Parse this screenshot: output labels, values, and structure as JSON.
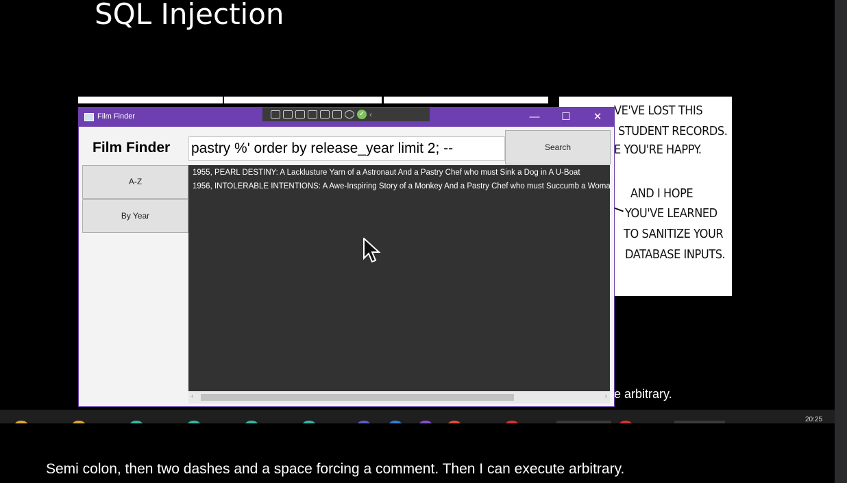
{
  "slide": {
    "title": "SQL Injection"
  },
  "comic": {
    "lines": [
      "VE'VE LOST THIS",
      "STUDENT RECORDS.",
      "E YOU'RE HAPPY.",
      "AND I HOPE",
      "YOU'VE LEARNED",
      "TO SANITIZE YOUR",
      "DATABASE INPUTS."
    ]
  },
  "window": {
    "title": "Film Finder",
    "minimize": "—",
    "maximize": "☐",
    "close": "✕",
    "heading": "Film Finder",
    "search_value": "pastry %' order by release_year limit 2; --",
    "search_button": "Search",
    "sort_az": "A-Z",
    "sort_year": "By Year",
    "results": [
      "1955, PEARL DESTINY: A Lacklusture Yarn of a Astronaut And a Pastry Chef who must Sink a Dog in A U-Boat",
      "1956, INTOLERABLE INTENTIONS: A Awe-Inspiring Story of a Monkey And a Pastry Chef who must Succumb a Woma"
    ]
  },
  "caption_behind": "e arbitrary.",
  "taskbar": {
    "time": "20:25"
  },
  "subtitle": "Semi colon, then two dashes and a space forcing a comment. Then I can execute arbitrary.",
  "colors": {
    "titlebar": "#6e3fb0",
    "results_bg": "#323232",
    "page_bg": "#000000"
  },
  "icons": [
    "app-icon",
    "minimize-icon",
    "maximize-icon",
    "close-icon",
    "cursor-icon",
    "checkmark-icon"
  ]
}
